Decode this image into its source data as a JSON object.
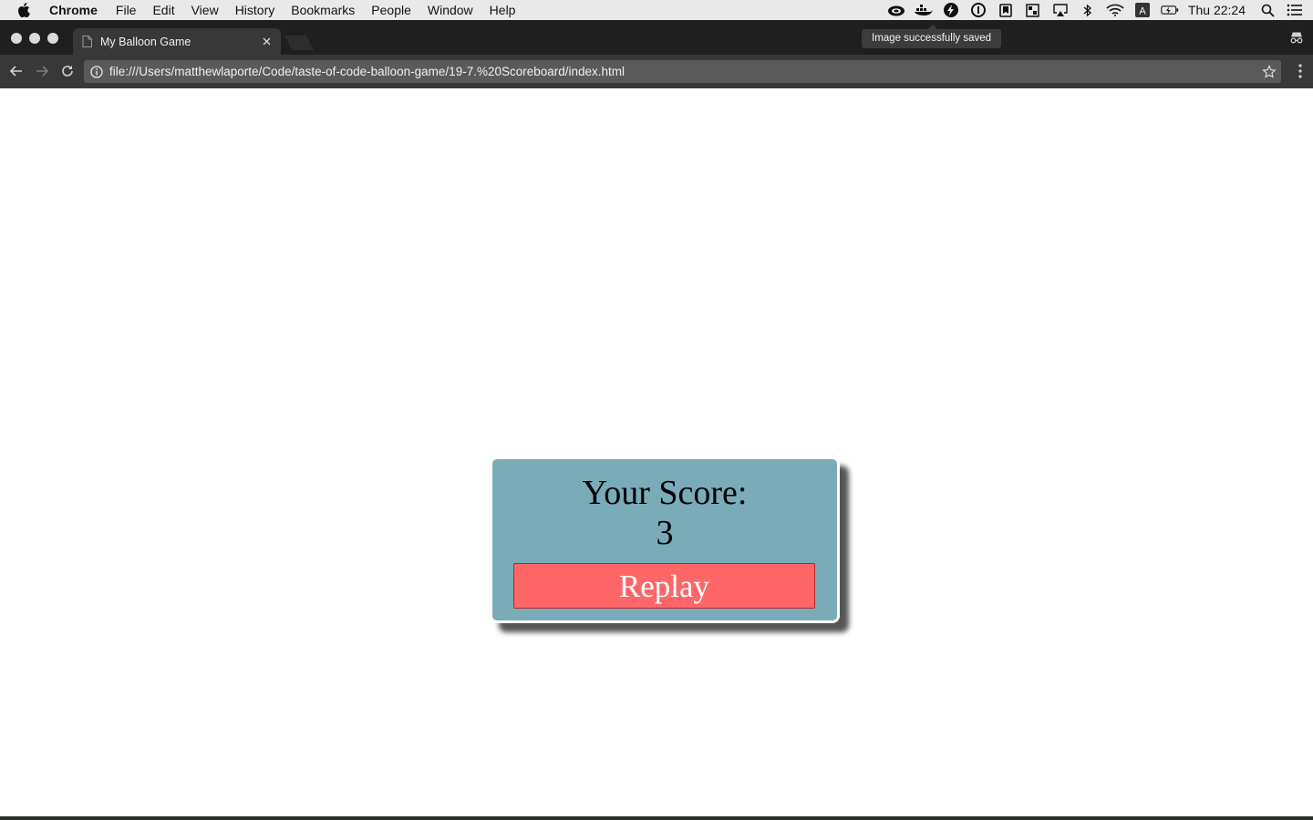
{
  "menubar": {
    "app_name": "Chrome",
    "items": [
      "File",
      "Edit",
      "View",
      "History",
      "Bookmarks",
      "People",
      "Window",
      "Help"
    ],
    "clock": "Thu 22:24"
  },
  "browser": {
    "tab_title": "My Balloon Game",
    "toast": "Image successfully saved",
    "url": "file:///Users/matthewlaporte/Code/taste-of-code-balloon-game/19-7.%20Scoreboard/index.html"
  },
  "scoreboard": {
    "label": "Your Score:",
    "score": "3",
    "replay_label": "Replay"
  },
  "colors": {
    "scoreboard_bg": "#7aabb8",
    "replay_bg": "#ff6668",
    "menubar_bg": "#e9e9e9",
    "toolbar_bg": "#383838"
  }
}
